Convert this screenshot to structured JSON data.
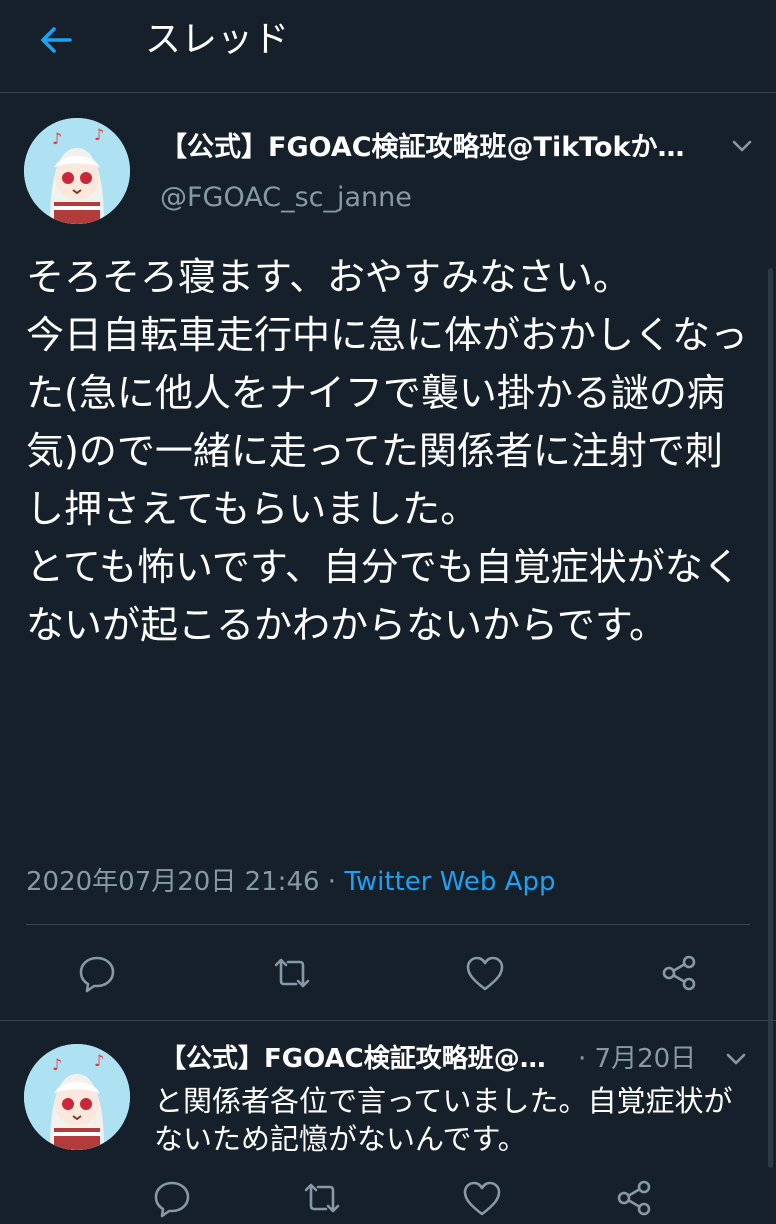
{
  "header": {
    "title": "スレッド"
  },
  "tweet": {
    "author_name": "【公式】FGOAC検証攻略班@TikTokか…",
    "author_handle": "@FGOAC_sc_janne",
    "text": "そろそろ寝ます、おやすみなさい。\n今日自転車走行中に急に体がおかしくなった(急に他人をナイフで襲い掛かる謎の病気)ので一緒に走ってた関係者に注射で刺し押さえてもらいました。\nとても怖いです、自分でも自覚症状がなくないが起こるかわからないからです。",
    "timestamp": "2020年07月20日 21:46",
    "separator": " · ",
    "source": "Twitter Web App"
  },
  "reply": {
    "author_name": "【公式】FGOAC検証攻略班@…",
    "date": "· 7月20日",
    "text": "と関係者各位で言っていました。自覚症状がないため記憶がないんです。"
  },
  "icons": [
    "back-arrow-icon",
    "chevron-down-icon",
    "reply-icon",
    "retweet-icon",
    "like-icon",
    "share-icon"
  ],
  "colors": {
    "background": "#15202b",
    "accent": "#1da1f2",
    "muted": "#8899a6",
    "divider": "#38444d"
  }
}
